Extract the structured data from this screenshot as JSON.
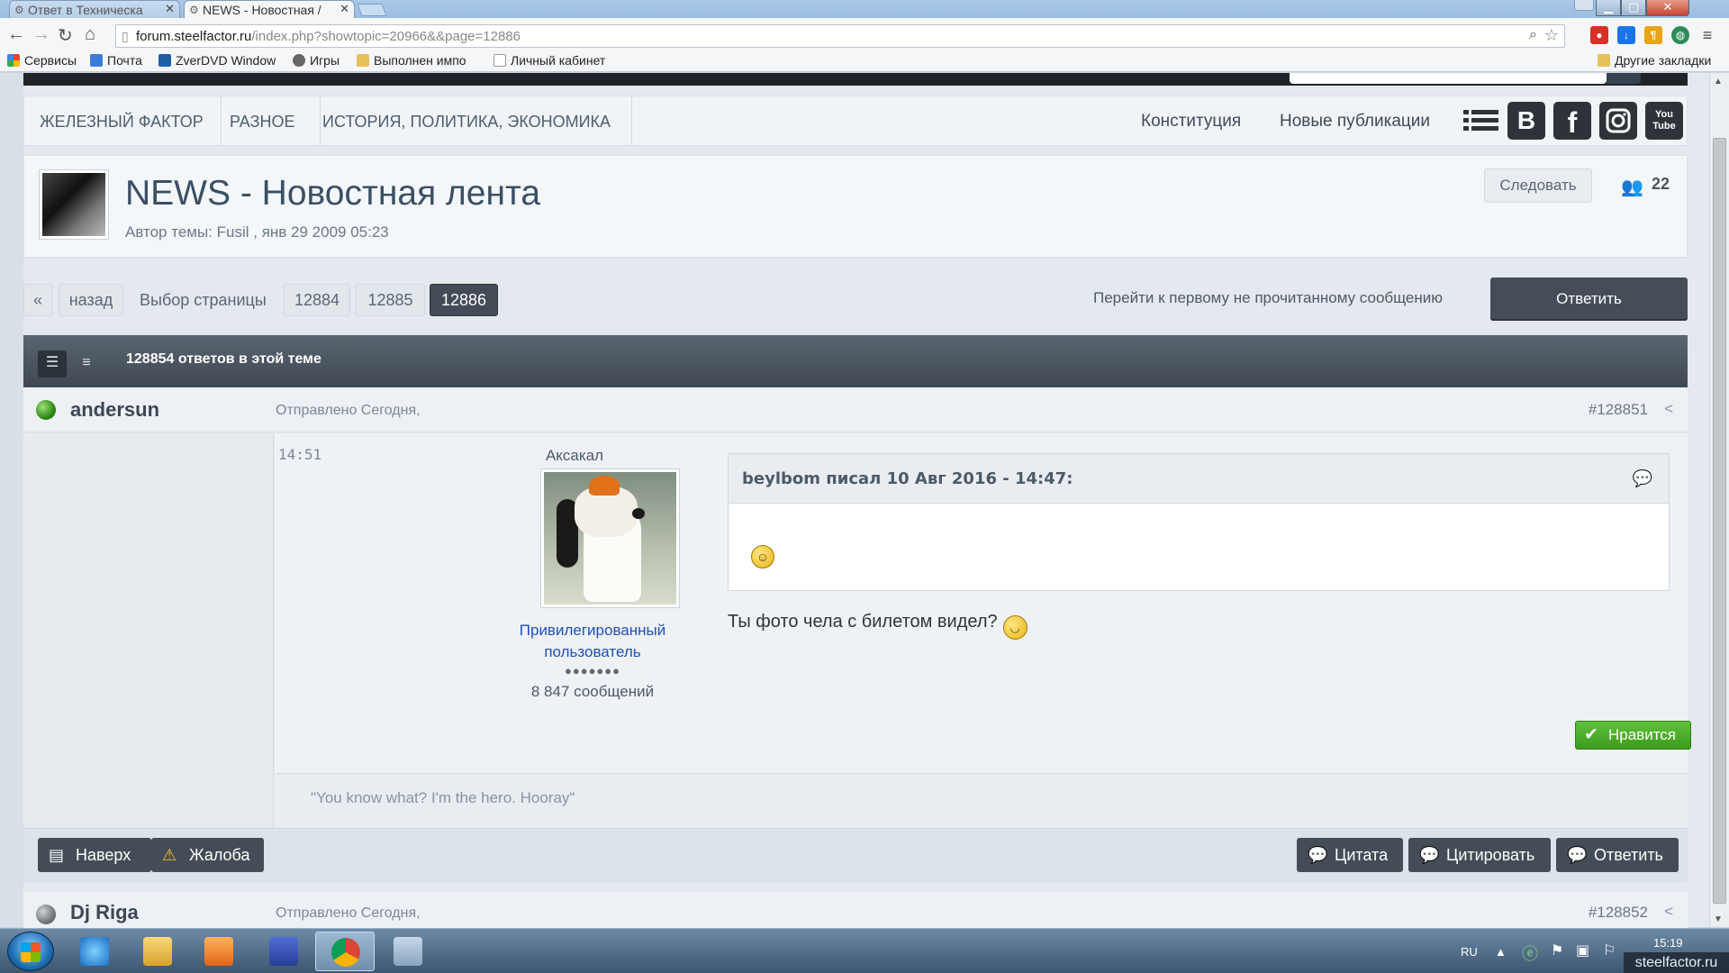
{
  "browser": {
    "tabs": [
      {
        "title": "Ответ в Техническа",
        "active": false
      },
      {
        "title": "NEWS - Новостная /",
        "active": true
      }
    ],
    "url_host": "forum.steelfactor.ru",
    "url_path": "/index.php?showtopic=20966&&page=12886",
    "bookmarks": [
      "Сервисы",
      "Почта",
      "ZverDVD Window",
      "Игры",
      "Выполнен импо",
      "Личный кабинет"
    ],
    "other_bookmarks": "Другие закладки"
  },
  "nav": {
    "crumbs": [
      "ЖЕЛЕЗНЫЙ ФАКТОР",
      "РАЗНОЕ",
      "ИСТОРИЯ, ПОЛИТИКА, ЭКОНОМИКА"
    ],
    "links": [
      "Конституция",
      "Новые публикации"
    ],
    "social_icons": [
      "list-icon",
      "vk-icon",
      "facebook-icon",
      "instagram-icon",
      "youtube-icon"
    ],
    "vk_label": "B",
    "fb_label": "f",
    "yt_label": "You Tube"
  },
  "topic": {
    "title": "NEWS - Новостная лента",
    "meta": "Автор темы: Fusil , янв 29 2009 05:23",
    "follow_label": "Следовать",
    "follower_count": "22"
  },
  "pager": {
    "first": "«",
    "back": "назад",
    "label": "Выбор страницы",
    "pages": [
      "12884",
      "12885",
      "12886"
    ],
    "current": "12886",
    "unread_link": "Перейти к первому не прочитанному сообщению",
    "reply_label": "Ответить"
  },
  "thread": {
    "reply_count_text": "128854 ответов в этой теме"
  },
  "post": {
    "author": "andersun",
    "posted": "Отправлено Сегодня,",
    "time": "14:51",
    "number": "#128851",
    "rank": "Аксакал",
    "group": "Привилегированный пользователь",
    "pips": "●●●●●●●",
    "post_count": "8 847 сообщений",
    "quote_cite": "beylbom писал 10 Авг 2016 - 14:47:",
    "text": "Ты фото чела с билетом видел?",
    "like_label": "Нравится",
    "signature": "\"You know what? I'm the hero. Hooray\"",
    "footer_left": [
      "Наверх",
      "Жалоба"
    ],
    "footer_right": [
      "Цитата",
      "Цитировать",
      "Ответить"
    ]
  },
  "next_post": {
    "author": "Dj Riga",
    "posted": "Отправлено Сегодня,",
    "number": "#128852"
  },
  "taskbar": {
    "lang": "RU",
    "clock": "15:19",
    "corner_label": "steelfactor.ru"
  }
}
